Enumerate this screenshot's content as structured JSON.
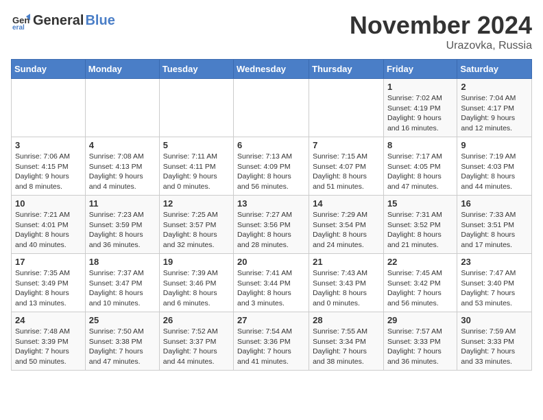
{
  "header": {
    "logo_line1": "General",
    "logo_line2": "Blue",
    "month": "November 2024",
    "location": "Urazovka, Russia"
  },
  "weekdays": [
    "Sunday",
    "Monday",
    "Tuesday",
    "Wednesday",
    "Thursday",
    "Friday",
    "Saturday"
  ],
  "weeks": [
    [
      {
        "day": "",
        "info": ""
      },
      {
        "day": "",
        "info": ""
      },
      {
        "day": "",
        "info": ""
      },
      {
        "day": "",
        "info": ""
      },
      {
        "day": "",
        "info": ""
      },
      {
        "day": "1",
        "info": "Sunrise: 7:02 AM\nSunset: 4:19 PM\nDaylight: 9 hours and 16 minutes."
      },
      {
        "day": "2",
        "info": "Sunrise: 7:04 AM\nSunset: 4:17 PM\nDaylight: 9 hours and 12 minutes."
      }
    ],
    [
      {
        "day": "3",
        "info": "Sunrise: 7:06 AM\nSunset: 4:15 PM\nDaylight: 9 hours and 8 minutes."
      },
      {
        "day": "4",
        "info": "Sunrise: 7:08 AM\nSunset: 4:13 PM\nDaylight: 9 hours and 4 minutes."
      },
      {
        "day": "5",
        "info": "Sunrise: 7:11 AM\nSunset: 4:11 PM\nDaylight: 9 hours and 0 minutes."
      },
      {
        "day": "6",
        "info": "Sunrise: 7:13 AM\nSunset: 4:09 PM\nDaylight: 8 hours and 56 minutes."
      },
      {
        "day": "7",
        "info": "Sunrise: 7:15 AM\nSunset: 4:07 PM\nDaylight: 8 hours and 51 minutes."
      },
      {
        "day": "8",
        "info": "Sunrise: 7:17 AM\nSunset: 4:05 PM\nDaylight: 8 hours and 47 minutes."
      },
      {
        "day": "9",
        "info": "Sunrise: 7:19 AM\nSunset: 4:03 PM\nDaylight: 8 hours and 44 minutes."
      }
    ],
    [
      {
        "day": "10",
        "info": "Sunrise: 7:21 AM\nSunset: 4:01 PM\nDaylight: 8 hours and 40 minutes."
      },
      {
        "day": "11",
        "info": "Sunrise: 7:23 AM\nSunset: 3:59 PM\nDaylight: 8 hours and 36 minutes."
      },
      {
        "day": "12",
        "info": "Sunrise: 7:25 AM\nSunset: 3:57 PM\nDaylight: 8 hours and 32 minutes."
      },
      {
        "day": "13",
        "info": "Sunrise: 7:27 AM\nSunset: 3:56 PM\nDaylight: 8 hours and 28 minutes."
      },
      {
        "day": "14",
        "info": "Sunrise: 7:29 AM\nSunset: 3:54 PM\nDaylight: 8 hours and 24 minutes."
      },
      {
        "day": "15",
        "info": "Sunrise: 7:31 AM\nSunset: 3:52 PM\nDaylight: 8 hours and 21 minutes."
      },
      {
        "day": "16",
        "info": "Sunrise: 7:33 AM\nSunset: 3:51 PM\nDaylight: 8 hours and 17 minutes."
      }
    ],
    [
      {
        "day": "17",
        "info": "Sunrise: 7:35 AM\nSunset: 3:49 PM\nDaylight: 8 hours and 13 minutes."
      },
      {
        "day": "18",
        "info": "Sunrise: 7:37 AM\nSunset: 3:47 PM\nDaylight: 8 hours and 10 minutes."
      },
      {
        "day": "19",
        "info": "Sunrise: 7:39 AM\nSunset: 3:46 PM\nDaylight: 8 hours and 6 minutes."
      },
      {
        "day": "20",
        "info": "Sunrise: 7:41 AM\nSunset: 3:44 PM\nDaylight: 8 hours and 3 minutes."
      },
      {
        "day": "21",
        "info": "Sunrise: 7:43 AM\nSunset: 3:43 PM\nDaylight: 8 hours and 0 minutes."
      },
      {
        "day": "22",
        "info": "Sunrise: 7:45 AM\nSunset: 3:42 PM\nDaylight: 7 hours and 56 minutes."
      },
      {
        "day": "23",
        "info": "Sunrise: 7:47 AM\nSunset: 3:40 PM\nDaylight: 7 hours and 53 minutes."
      }
    ],
    [
      {
        "day": "24",
        "info": "Sunrise: 7:48 AM\nSunset: 3:39 PM\nDaylight: 7 hours and 50 minutes."
      },
      {
        "day": "25",
        "info": "Sunrise: 7:50 AM\nSunset: 3:38 PM\nDaylight: 7 hours and 47 minutes."
      },
      {
        "day": "26",
        "info": "Sunrise: 7:52 AM\nSunset: 3:37 PM\nDaylight: 7 hours and 44 minutes."
      },
      {
        "day": "27",
        "info": "Sunrise: 7:54 AM\nSunset: 3:36 PM\nDaylight: 7 hours and 41 minutes."
      },
      {
        "day": "28",
        "info": "Sunrise: 7:55 AM\nSunset: 3:34 PM\nDaylight: 7 hours and 38 minutes."
      },
      {
        "day": "29",
        "info": "Sunrise: 7:57 AM\nSunset: 3:33 PM\nDaylight: 7 hours and 36 minutes."
      },
      {
        "day": "30",
        "info": "Sunrise: 7:59 AM\nSunset: 3:33 PM\nDaylight: 7 hours and 33 minutes."
      }
    ]
  ]
}
